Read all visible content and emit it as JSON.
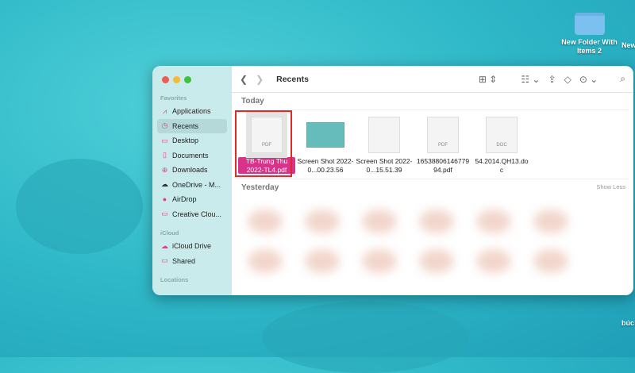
{
  "desktop": {
    "items": [
      {
        "label": "New Folder With Items 2"
      },
      {
        "label": "New"
      },
      {
        "label": "búc"
      }
    ]
  },
  "window": {
    "title": "Recents",
    "sidebar": {
      "favorites_label": "Favorites",
      "favorites": [
        {
          "label": "Applications",
          "icon": "applications-icon"
        },
        {
          "label": "Recents",
          "icon": "clock-icon"
        },
        {
          "label": "Desktop",
          "icon": "desktop-icon"
        },
        {
          "label": "Documents",
          "icon": "document-icon"
        },
        {
          "label": "Downloads",
          "icon": "download-icon"
        },
        {
          "label": "OneDrive - M...",
          "icon": "cloud-icon"
        },
        {
          "label": "AirDrop",
          "icon": "airdrop-icon"
        },
        {
          "label": "Creative Clou...",
          "icon": "folder-icon"
        }
      ],
      "icloud_label": "iCloud",
      "icloud": [
        {
          "label": "iCloud Drive",
          "icon": "cloud-icon"
        },
        {
          "label": "Shared",
          "icon": "shared-folder-icon"
        }
      ],
      "locations_label": "Locations"
    },
    "groups": {
      "today": "Today",
      "yesterday": "Yesterday",
      "show_less": "Show Less"
    },
    "files": [
      {
        "name": "TB-Trung Thu 2022-TL4.pdf",
        "badge": "PDF"
      },
      {
        "name": "Screen Shot 2022-0...00.23.56",
        "badge": ""
      },
      {
        "name": "Screen Shot 2022-0...15.51.39",
        "badge": ""
      },
      {
        "name": "16538806146779 94.pdf",
        "badge": "PDF"
      },
      {
        "name": "54.2014.QH13.do c",
        "badge": "DOC"
      }
    ]
  }
}
